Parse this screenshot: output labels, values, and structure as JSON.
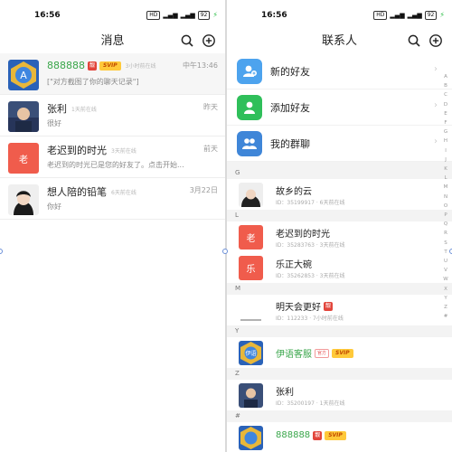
{
  "status": {
    "time": "16:56",
    "net": "HD",
    "battery": "92"
  },
  "messages": {
    "title": "消息",
    "items": [
      {
        "name": "888888",
        "badge": "靓",
        "svip": "SVIP",
        "online": "3小时前在线",
        "time": "中午13:46",
        "msg": "[\"对方截图了你的聊天记录\"]"
      },
      {
        "name": "张利",
        "online": "1天前在线",
        "time": "昨天",
        "msg": "很好"
      },
      {
        "name": "老迟到的时光",
        "avatar_text": "老",
        "online": "3天前在线",
        "time": "前天",
        "msg": "老迟到的时光已是您的好友了。点击开始..."
      },
      {
        "name": "想人陪的铅笔",
        "online": "6天前在线",
        "time": "3月22日",
        "msg": "你好"
      }
    ]
  },
  "contacts": {
    "title": "联系人",
    "functions": [
      {
        "label": "新的好友",
        "icon": "new-friend-icon",
        "color": "#4da3ee"
      },
      {
        "label": "添加好友",
        "icon": "add-friend-icon",
        "color": "#2fbf5a"
      },
      {
        "label": "我的群聊",
        "icon": "group-chat-icon",
        "color": "#3f86d8"
      }
    ],
    "sections": {
      "g": "G",
      "l": "L",
      "m": "M",
      "y": "Y",
      "z": "Z",
      "hash": "#"
    },
    "list": {
      "gxy": {
        "name": "故乡的云",
        "id": "ID：35199917 · 6天前在线"
      },
      "lcd": {
        "name": "老迟到的时光",
        "avatar": "老",
        "id": "ID：35283763 · 3天前在线"
      },
      "lzd": {
        "name": "乐正大碗",
        "avatar": "乐",
        "id": "ID：35262853 · 3天前在线"
      },
      "mth": {
        "name": "明天会更好",
        "badge": "靓",
        "id": "ID：112233 · 7小时前在线"
      },
      "yyk": {
        "name": "伊语客服",
        "shop": "官方",
        "svip": "SVIP",
        "avatar": "伊语"
      },
      "zl": {
        "name": "张利",
        "id": "ID：35200197 · 1天前在线"
      },
      "last": {
        "name": "888888",
        "badge": "靓",
        "svip": "SVIP"
      }
    },
    "alphabet": [
      "A",
      "B",
      "C",
      "D",
      "E",
      "F",
      "G",
      "H",
      "I",
      "J",
      "K",
      "L",
      "M",
      "N",
      "O",
      "P",
      "Q",
      "R",
      "S",
      "T",
      "U",
      "V",
      "W",
      "X",
      "Y",
      "Z",
      "#"
    ]
  }
}
